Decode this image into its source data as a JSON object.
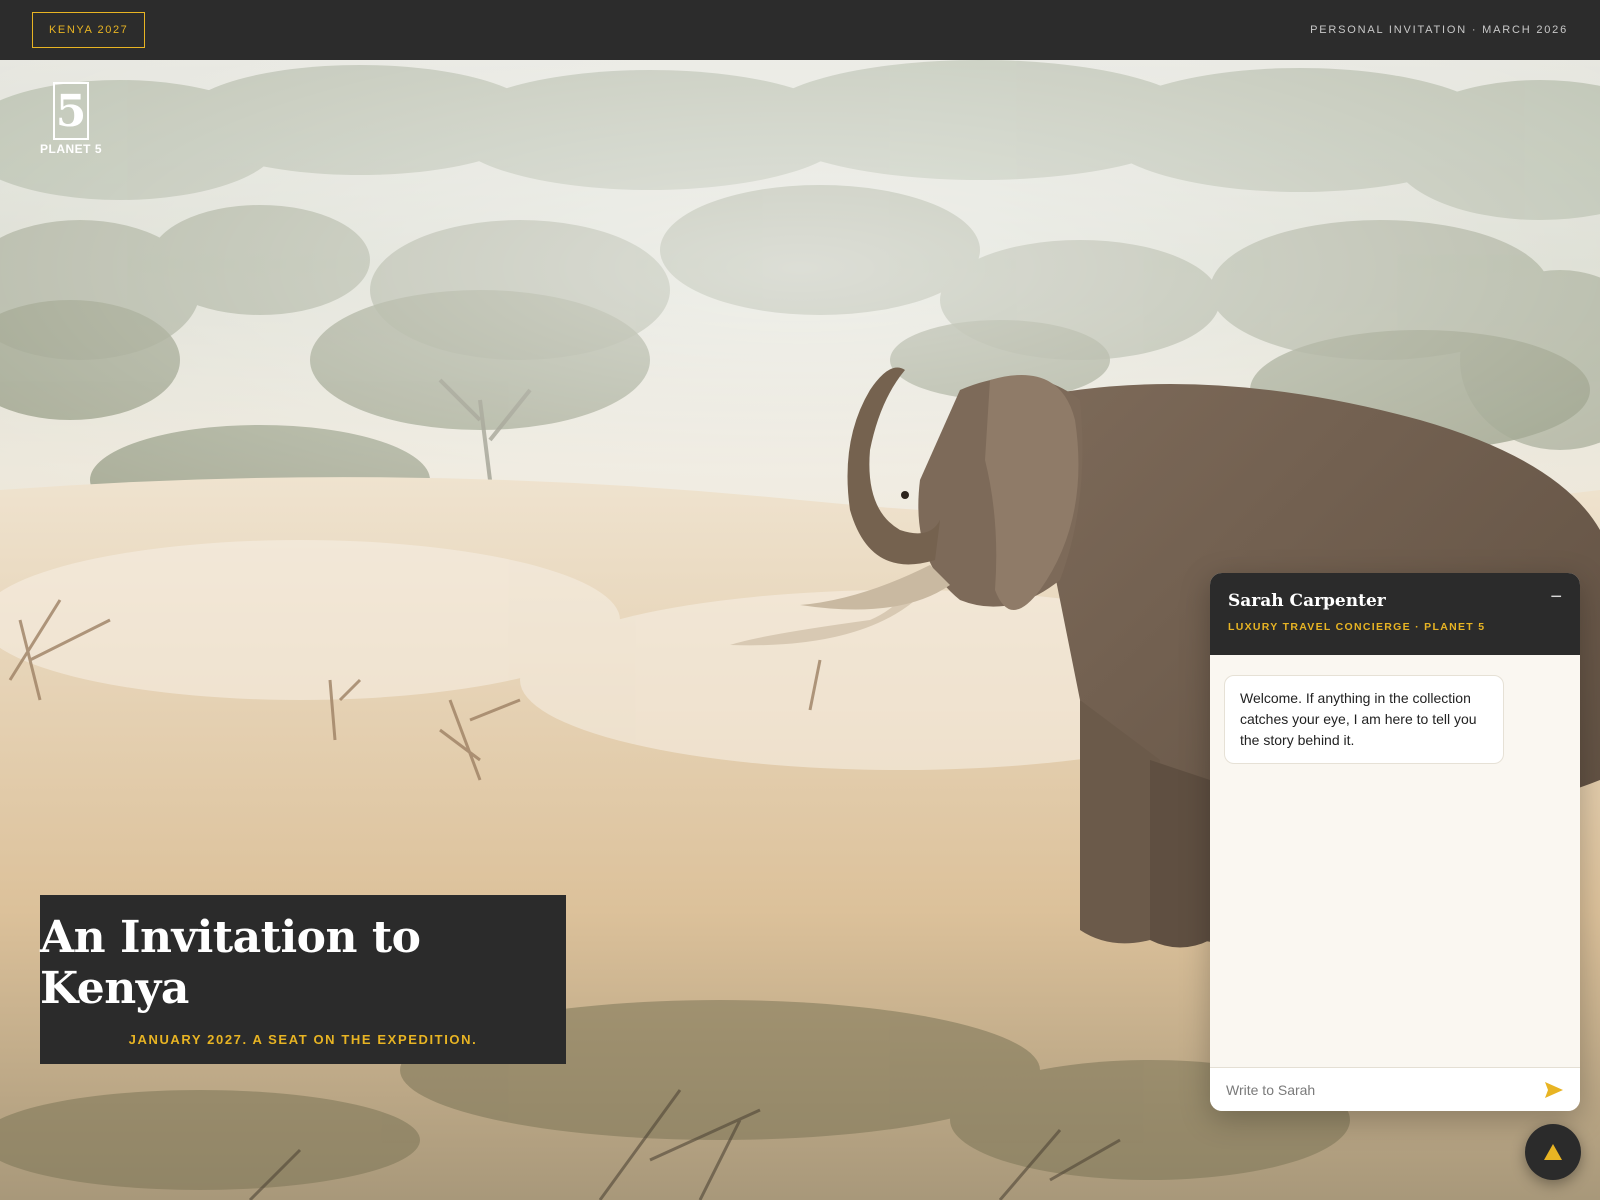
{
  "topbar": {
    "badge": "KENYA 2027",
    "note": "PERSONAL INVITATION · MARCH 2026"
  },
  "logo": {
    "glyph": "5",
    "text": "PLANET 5"
  },
  "hero_image": {
    "icon": "elephant-savanna-photo"
  },
  "invite": {
    "title": "An Invitation to Kenya",
    "subtitle": "JANUARY 2027. A SEAT ON THE EXPEDITION."
  },
  "chat": {
    "name": "Sarah Carpenter",
    "role": "LUXURY TRAVEL CONCIERGE · PLANET 5",
    "minimize_label": "−",
    "messages": [
      {
        "text": "Welcome. If anything in the collection catches your eye, I am here to tell you the story behind it."
      }
    ],
    "input_placeholder": "Write to Sarah",
    "send_icon": "send-icon"
  },
  "fab": {
    "icon": "up-triangle-icon"
  },
  "colors": {
    "dark": "#2b2b2b",
    "accent": "#e8b423",
    "chat_bg": "#faf7f1"
  }
}
